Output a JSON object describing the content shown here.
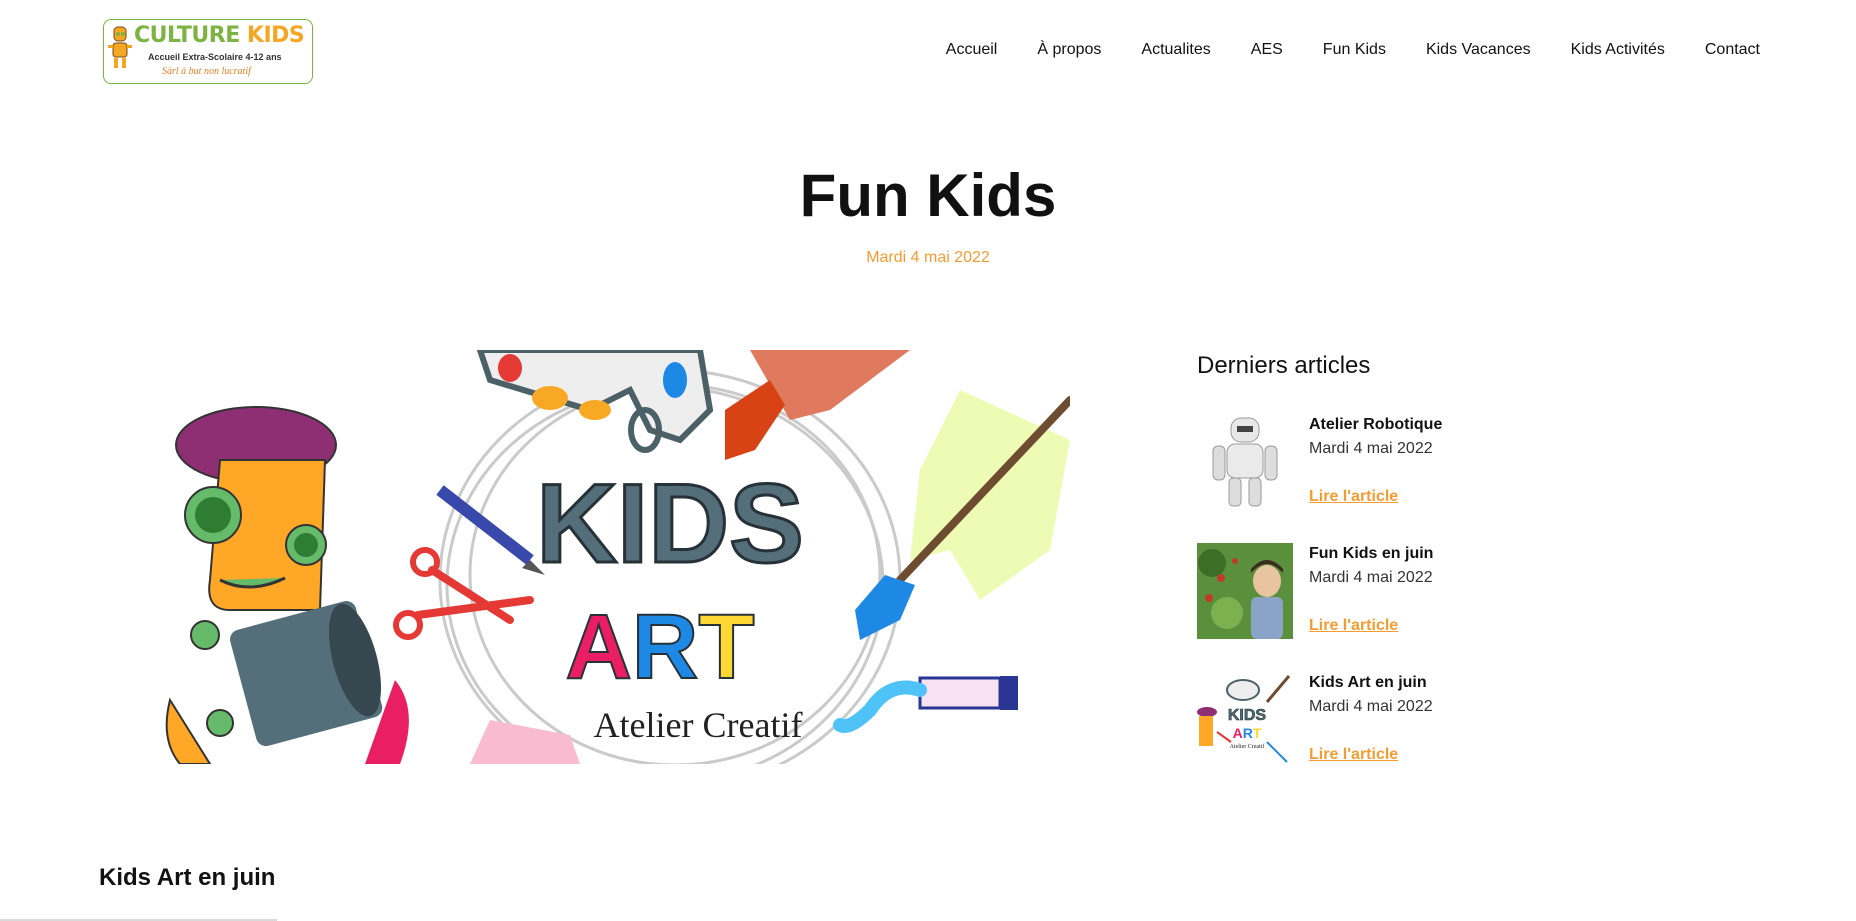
{
  "header": {
    "logo": {
      "title_part1": "CULTURE",
      "title_part2": "KIDS",
      "subtitle": "Accueil Extra-Scolaire 4-12 ans",
      "tagline": "Sàrl à but non lucratif"
    },
    "nav": [
      {
        "label": "Accueil"
      },
      {
        "label": "À propos"
      },
      {
        "label": "Actualites"
      },
      {
        "label": "AES"
      },
      {
        "label": "Fun Kids"
      },
      {
        "label": "Kids Vacances"
      },
      {
        "label": "Kids Activités"
      },
      {
        "label": "Contact"
      }
    ]
  },
  "hero": {
    "title": "Fun Kids",
    "date": "Mardi 4 mai 2022"
  },
  "featured_image": {
    "line1": "KIDS",
    "line2": "ART",
    "line3": "Atelier Creatif"
  },
  "sidebar": {
    "heading": "Derniers articles",
    "articles": [
      {
        "title": "Atelier Robotique",
        "date": "Mardi 4 mai 2022",
        "link": "Lire l'article"
      },
      {
        "title": "Fun Kids en juin",
        "date": "Mardi 4 mai 2022",
        "link": "Lire l'article"
      },
      {
        "title": "Kids Art en juin",
        "date": "Mardi 4 mai 2022",
        "link": "Lire l'article"
      }
    ]
  },
  "content": {
    "section_title": "Kids Art en juin"
  },
  "colors": {
    "accent": "#f39c32",
    "logo_green": "#7cb342",
    "logo_orange": "#f5a623"
  }
}
